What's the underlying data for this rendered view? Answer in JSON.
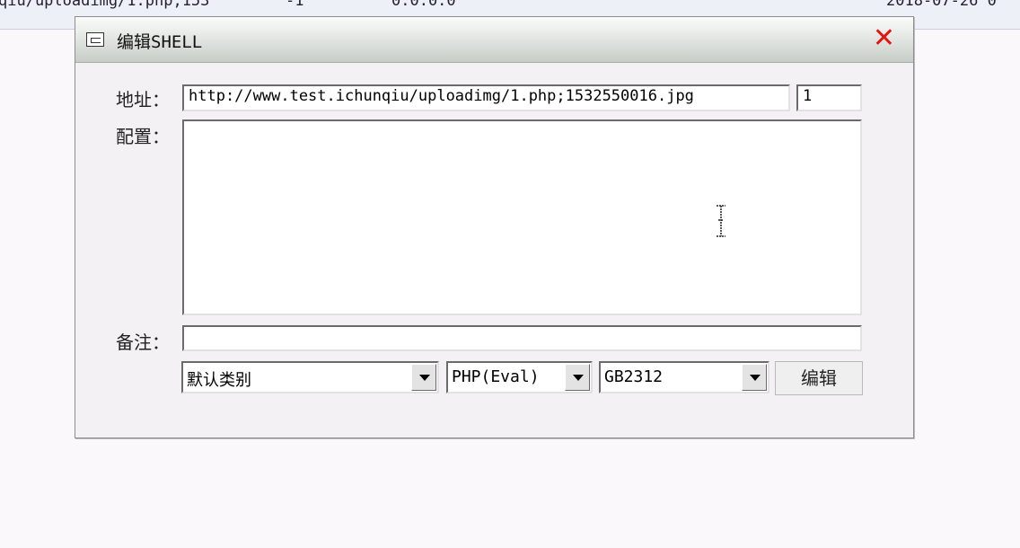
{
  "background_row": {
    "path": "qiu/uploadimg/1.php;153",
    "id": "-1",
    "ip": "0.0.0.0",
    "date": "2018-07-26 0"
  },
  "dialog": {
    "title": "编辑SHELL",
    "close_icon": "close-x",
    "labels": {
      "address": "地址：",
      "config": "配置：",
      "note": "备注："
    },
    "address_value": "http://www.test.ichunqiu/uploadimg/1.php;1532550016.jpg",
    "password_value": "1",
    "config_value": "",
    "note_value": "",
    "category_select": "默认类别",
    "type_select": "PHP(Eval)",
    "encoding_select": "GB2312",
    "submit_label": "编辑"
  },
  "colors": {
    "close": "#e3130f",
    "titlebar": "#dfe3df"
  }
}
